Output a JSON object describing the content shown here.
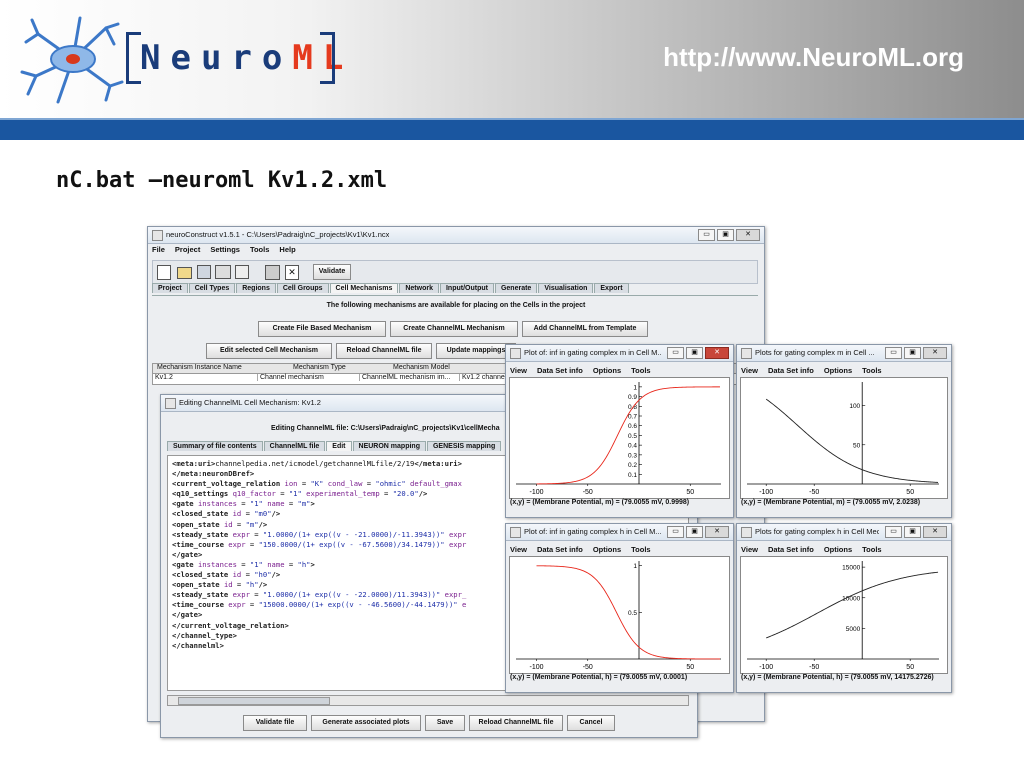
{
  "slide": {
    "url": "http://www.NeuroML.org",
    "logo_main": "Neuro",
    "logo_accent": "ML",
    "command": "nC.bat –neuroml Kv1.2.xml"
  },
  "main_window": {
    "title": "neuroConstruct v1.5.1 - C:\\Users\\Padraig\\nC_projects\\Kv1\\Kv1.ncx",
    "menu": [
      "File",
      "Project",
      "Settings",
      "Tools",
      "Help"
    ],
    "validate_label": "Validate",
    "tabs": [
      "Project",
      "Cell Types",
      "Regions",
      "Cell Groups",
      "Cell Mechanisms",
      "Network",
      "Input/Output",
      "Generate",
      "Visualisation",
      "Export"
    ],
    "info": "The following mechanisms are available for placing on the Cells in the project",
    "buttons_row1": [
      "Create File Based Mechanism",
      "Create ChannelML Mechanism",
      "Add ChannelML from Template"
    ],
    "buttons_row2": [
      "Edit selected Cell Mechanism",
      "Reload ChannelML file",
      "Update mappings"
    ],
    "table_headers": [
      "Mechanism Instance Name",
      "Mechanism Type",
      "Mechanism Model",
      ""
    ],
    "table_row": [
      "Kv1.2",
      "Channel mechanism",
      "ChannelML mechanism im...",
      "Kv1.2 channe"
    ]
  },
  "editor": {
    "title": "Editing ChannelML Cell Mechanism: Kv1.2",
    "file_label": "Editing ChannelML file: C:\\Users\\Padraig\\nC_projects\\Kv1\\cellMecha",
    "tabs": [
      "Summary of file contents",
      "ChannelML file",
      "Edit",
      "NEURON mapping",
      "GENESIS mapping"
    ],
    "buttons": [
      "Validate file",
      "Generate associated plots",
      "Save",
      "Reload ChannelML file",
      "Cancel"
    ],
    "code_lines": [
      [
        [
          "tag",
          "<meta:uri>"
        ],
        [
          "txt",
          "channelpedia.net/icmodel/getchannelMLfile/2/19"
        ],
        [
          "tag",
          "</meta:uri>"
        ]
      ],
      [
        [
          "tag",
          "</meta:neuronDBref>"
        ]
      ],
      [
        [
          "tag",
          "<current_voltage_relation "
        ],
        [
          "att",
          "ion"
        ],
        [
          "txt",
          " = "
        ],
        [
          "val",
          "\"K\""
        ],
        [
          "att",
          " cond_law"
        ],
        [
          "txt",
          " = "
        ],
        [
          "val",
          "\"ohmic\""
        ],
        [
          "att",
          " default_gmax"
        ]
      ],
      [
        [
          "tag",
          "<q10_settings "
        ],
        [
          "att",
          "q10_factor"
        ],
        [
          "txt",
          " = "
        ],
        [
          "val",
          "\"1\""
        ],
        [
          "att",
          " experimental_temp"
        ],
        [
          "txt",
          " = "
        ],
        [
          "val",
          "\"20.0\""
        ],
        [
          "tag",
          "/>"
        ]
      ],
      [
        [
          "tag",
          "<gate "
        ],
        [
          "att",
          "instances"
        ],
        [
          "txt",
          " = "
        ],
        [
          "val",
          "\"1\""
        ],
        [
          "att",
          " name"
        ],
        [
          "txt",
          " = "
        ],
        [
          "val",
          "\"m\""
        ],
        [
          "tag",
          ">"
        ]
      ],
      [
        [
          "tag",
          "<closed_state "
        ],
        [
          "att",
          "id"
        ],
        [
          "txt",
          " = "
        ],
        [
          "val",
          "\"m0\""
        ],
        [
          "tag",
          "/>"
        ]
      ],
      [
        [
          "tag",
          "<open_state "
        ],
        [
          "att",
          "id"
        ],
        [
          "txt",
          " = "
        ],
        [
          "val",
          "\"m\""
        ],
        [
          "tag",
          "/>"
        ]
      ],
      [
        [
          "tag",
          "<steady_state "
        ],
        [
          "att",
          "expr"
        ],
        [
          "txt",
          " = "
        ],
        [
          "val",
          "\"1.0000/(1+ exp((v - -21.0000)/-11.3943))\""
        ],
        [
          "att",
          " expr"
        ]
      ],
      [
        [
          "tag",
          "<time_course "
        ],
        [
          "att",
          "expr"
        ],
        [
          "txt",
          " = "
        ],
        [
          "val",
          "\"150.0000/(1+ exp((v - -67.5600)/34.1479))\""
        ],
        [
          "att",
          " expr"
        ]
      ],
      [
        [
          "tag",
          "</gate>"
        ]
      ],
      [
        [
          "tag",
          "<gate "
        ],
        [
          "att",
          "instances"
        ],
        [
          "txt",
          " = "
        ],
        [
          "val",
          "\"1\""
        ],
        [
          "att",
          " name"
        ],
        [
          "txt",
          " = "
        ],
        [
          "val",
          "\"h\""
        ],
        [
          "tag",
          ">"
        ]
      ],
      [
        [
          "tag",
          "<closed_state "
        ],
        [
          "att",
          "id"
        ],
        [
          "txt",
          " = "
        ],
        [
          "val",
          "\"h0\""
        ],
        [
          "tag",
          "/>"
        ]
      ],
      [
        [
          "tag",
          "<open_state "
        ],
        [
          "att",
          "id"
        ],
        [
          "txt",
          " = "
        ],
        [
          "val",
          "\"h\""
        ],
        [
          "tag",
          "/>"
        ]
      ],
      [
        [
          "tag",
          "<steady_state "
        ],
        [
          "att",
          "expr"
        ],
        [
          "txt",
          " = "
        ],
        [
          "val",
          "\"1.0000/(1+ exp((v - -22.0000)/11.3943))\""
        ],
        [
          "att",
          " expr_"
        ]
      ],
      [
        [
          "tag",
          "<time_course "
        ],
        [
          "att",
          "expr"
        ],
        [
          "txt",
          " = "
        ],
        [
          "val",
          "\"15000.0000/(1+ exp((v - -46.5600)/-44.1479))\""
        ],
        [
          "att",
          " e"
        ]
      ],
      [
        [
          "tag",
          "</gate>"
        ]
      ],
      [
        [
          "tag",
          "</current_voltage_relation>"
        ]
      ],
      [
        [
          "tag",
          "</channel_type>"
        ]
      ],
      [
        [
          "tag",
          "</channelml>"
        ]
      ]
    ]
  },
  "plots": [
    {
      "id": "minf",
      "title": "Plot of: inf in gating complex m in Cell M...",
      "menu": [
        "View",
        "Data Set info",
        "Options",
        "Tools"
      ],
      "status": "(x,y) = (Membrane Potential, m) = (79.0055 mV, 0.9998)",
      "close_red": true,
      "chart_data": {
        "type": "line",
        "xlim": [
          -120,
          80
        ],
        "ylim": [
          0,
          1.05
        ],
        "xticks": [
          -100,
          -50,
          50
        ],
        "yticks": [
          1,
          0.9,
          0.8,
          0.7,
          0.6,
          0.5,
          0.4,
          0.3,
          0.2,
          0.1
        ],
        "ytick_labels": [
          "1",
          "0.9",
          "0.8",
          "0.7",
          "0.6",
          "0.5",
          "0.4",
          "0.3",
          "0.2",
          "0.1"
        ],
        "func": "minf",
        "color": "#e8261a"
      }
    },
    {
      "id": "mtau",
      "title": "Plots for gating complex m in Cell ...",
      "menu": [
        "View",
        "Data Set info",
        "Options",
        "Tools"
      ],
      "status": "(x,y) = (Membrane Potential, m) = (79.0055 mV, 2.0238)",
      "close_red": false,
      "chart_data": {
        "type": "line",
        "xlim": [
          -120,
          80
        ],
        "ylim": [
          0,
          130
        ],
        "xticks": [
          -100,
          -50,
          50
        ],
        "yticks": [
          100,
          50
        ],
        "ytick_labels": [
          "100",
          "50"
        ],
        "func": "mtau",
        "color": "#222222"
      }
    },
    {
      "id": "hinf",
      "title": "Plot of: inf in gating complex h in Cell M...",
      "menu": [
        "View",
        "Data Set info",
        "Options",
        "Tools"
      ],
      "status": "(x,y) = (Membrane Potential, h) = (79.0055 mV, 0.0001)",
      "close_red": false,
      "chart_data": {
        "type": "line",
        "xlim": [
          -120,
          80
        ],
        "ylim": [
          0,
          1.05
        ],
        "xticks": [
          -100,
          -50,
          50
        ],
        "yticks": [
          1,
          0.5
        ],
        "ytick_labels": [
          "1",
          "0.5"
        ],
        "func": "hinf",
        "color": "#e8261a"
      }
    },
    {
      "id": "htau",
      "title": "Plots for gating complex h in Cell Mec...",
      "menu": [
        "View",
        "Data Set info",
        "Options",
        "Tools"
      ],
      "status": "(x,y) = (Membrane Potential, h) = (79.0055 mV, 14175.2726)",
      "close_red": false,
      "chart_data": {
        "type": "line",
        "xlim": [
          -120,
          80
        ],
        "ylim": [
          0,
          16000
        ],
        "xticks": [
          -100,
          -50,
          50
        ],
        "yticks": [
          15000,
          10000,
          5000
        ],
        "ytick_labels": [
          "15000",
          "10000",
          "5000"
        ],
        "func": "htau",
        "color": "#222222"
      }
    }
  ]
}
